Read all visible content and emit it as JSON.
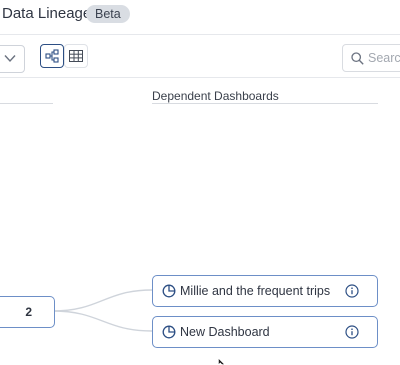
{
  "header": {
    "title": "Data Lineage",
    "badge": "Beta"
  },
  "toolbar": {
    "search_placeholder": "Search",
    "view_mode_icons": [
      "graph-view-icon",
      "table-view-icon"
    ],
    "active_view": "graph"
  },
  "columns": {
    "right_header": "Dependent Dashboards"
  },
  "source_node": {
    "count": "2"
  },
  "dashboards": [
    {
      "label": "Millie and the frequent trips",
      "icon": "dashboard-pie-icon"
    },
    {
      "label": "New Dashboard",
      "icon": "dashboard-pie-icon"
    }
  ],
  "colors": {
    "accent": "#2d4f84",
    "node_border": "#6d8fc7",
    "edge": "#cfd4db"
  }
}
